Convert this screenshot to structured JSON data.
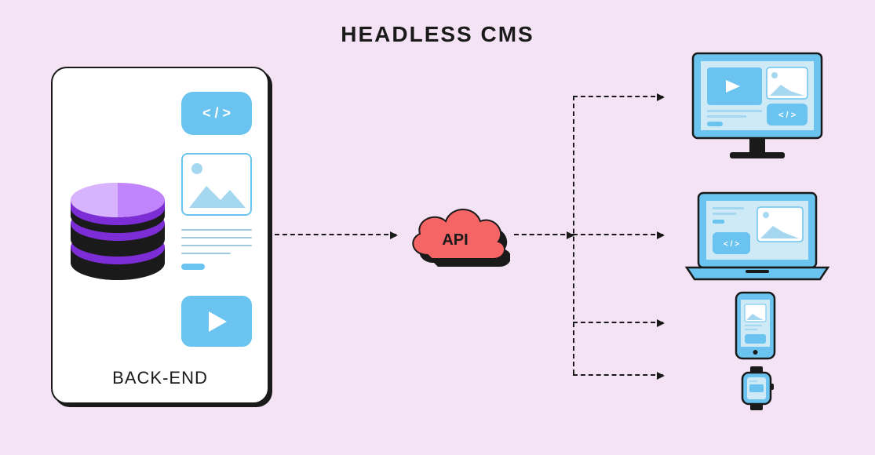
{
  "title": "HEADLESS CMS",
  "backend": {
    "label": "BACK-END",
    "code_symbol": "< / >"
  },
  "api": {
    "label": "API"
  },
  "devices": {
    "desktop": "desktop-monitor",
    "laptop": "laptop",
    "phone": "smartphone",
    "watch": "smartwatch"
  },
  "colors": {
    "bg": "#f3e3f5",
    "accent_blue": "#6bc4f0",
    "purple": "#a855f7",
    "purple_dark": "#7c2dd6",
    "api_pink": "#f56565",
    "black": "#1a1a1a"
  }
}
